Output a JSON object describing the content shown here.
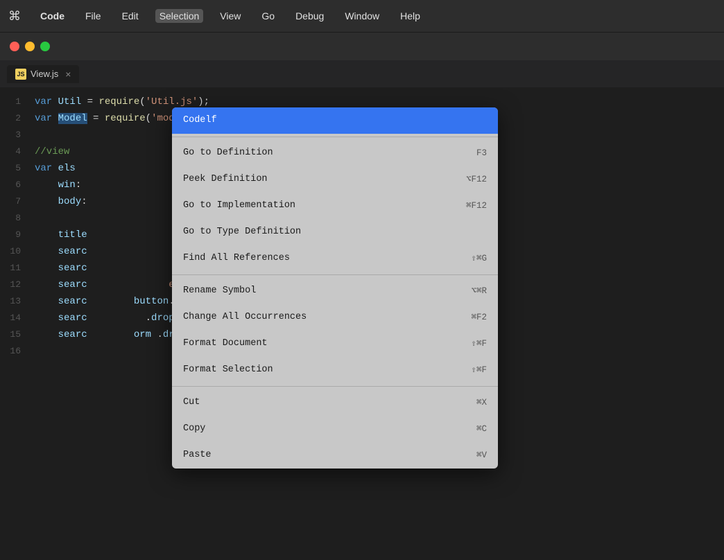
{
  "menubar": {
    "apple": "⌘",
    "items": [
      {
        "label": "Code",
        "bold": true
      },
      {
        "label": "File"
      },
      {
        "label": "Edit"
      },
      {
        "label": "Selection",
        "active": true
      },
      {
        "label": "View"
      },
      {
        "label": "Go"
      },
      {
        "label": "Debug"
      },
      {
        "label": "Window"
      },
      {
        "label": "Help"
      }
    ]
  },
  "tab": {
    "icon": "JS",
    "name": "View.js",
    "close": "×"
  },
  "editor": {
    "lines": [
      {
        "num": "1",
        "content": "var Util = require('Util.js');"
      },
      {
        "num": "2",
        "content": "var Model = require('model/Model.js');"
      },
      {
        "num": "3",
        "content": ""
      },
      {
        "num": "4",
        "content": "//view"
      },
      {
        "num": "5",
        "content": "var els"
      },
      {
        "num": "6",
        "content": "    win:"
      },
      {
        "num": "7",
        "content": "    body:"
      },
      {
        "num": "8",
        "content": ""
      },
      {
        "num": "9",
        "content": "    title"
      },
      {
        "num": "10",
        "content": "    searc"
      },
      {
        "num": "11",
        "content": "    searc                  ),"
      },
      {
        "num": "12",
        "content": "    searc              earch'),"
      },
      {
        "num": "13",
        "content": "    searc        button.dropdown-toggl"
      },
      {
        "num": "14",
        "content": "    searc          .dropdown-menu'),"
      },
      {
        "num": "15",
        "content": "    searc        orm .dropdown-menu sc"
      },
      {
        "num": "16",
        "content": ""
      }
    ]
  },
  "context_menu": {
    "items": [
      {
        "id": "codelf",
        "label": "Codelf",
        "shortcut": "",
        "selected": true,
        "group": 0
      },
      {
        "id": "go-to-definition",
        "label": "Go to Definition",
        "shortcut": "F3",
        "selected": false,
        "group": 1
      },
      {
        "id": "peek-definition",
        "label": "Peek Definition",
        "shortcut": "⌥F12",
        "selected": false,
        "group": 1
      },
      {
        "id": "go-to-implementation",
        "label": "Go to Implementation",
        "shortcut": "⌘F12",
        "selected": false,
        "group": 1
      },
      {
        "id": "go-to-type-definition",
        "label": "Go to Type Definition",
        "shortcut": "",
        "selected": false,
        "group": 1
      },
      {
        "id": "find-all-references",
        "label": "Find All References",
        "shortcut": "⇧⌘G",
        "selected": false,
        "group": 1
      },
      {
        "id": "rename-symbol",
        "label": "Rename Symbol",
        "shortcut": "⌥⌘R",
        "selected": false,
        "group": 2
      },
      {
        "id": "change-all-occurrences",
        "label": "Change All Occurrences",
        "shortcut": "⌘F2",
        "selected": false,
        "group": 2
      },
      {
        "id": "format-document",
        "label": "Format Document",
        "shortcut": "⇧⌘F",
        "selected": false,
        "group": 2
      },
      {
        "id": "format-selection",
        "label": "Format Selection",
        "shortcut": "⇧⌘F",
        "selected": false,
        "group": 2
      },
      {
        "id": "cut",
        "label": "Cut",
        "shortcut": "⌘X",
        "selected": false,
        "group": 3
      },
      {
        "id": "copy",
        "label": "Copy",
        "shortcut": "⌘C",
        "selected": false,
        "group": 3
      },
      {
        "id": "paste",
        "label": "Paste",
        "shortcut": "⌘V",
        "selected": false,
        "group": 3
      }
    ]
  }
}
